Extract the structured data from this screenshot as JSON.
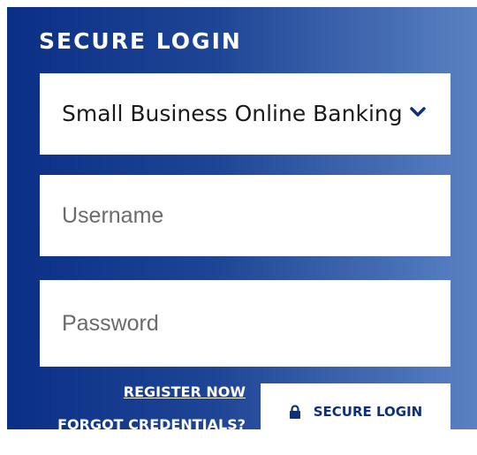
{
  "login": {
    "title": "SECURE LOGIN",
    "account_type": {
      "selected": "Small Business Online Banking",
      "icon": "chevron-down-icon"
    },
    "username": {
      "placeholder": "Username",
      "value": ""
    },
    "password": {
      "placeholder": "Password",
      "value": ""
    },
    "register_link": "REGISTER NOW",
    "forgot_link": "FORGOT CREDENTIALS?",
    "submit_button": {
      "label": "SECURE LOGIN",
      "icon": "lock-icon"
    }
  },
  "colors": {
    "panel_gradient_start": "#0a2f86",
    "panel_gradient_end": "#5a82c2",
    "button_text": "#0f2f7a",
    "field_background": "#ffffff"
  }
}
